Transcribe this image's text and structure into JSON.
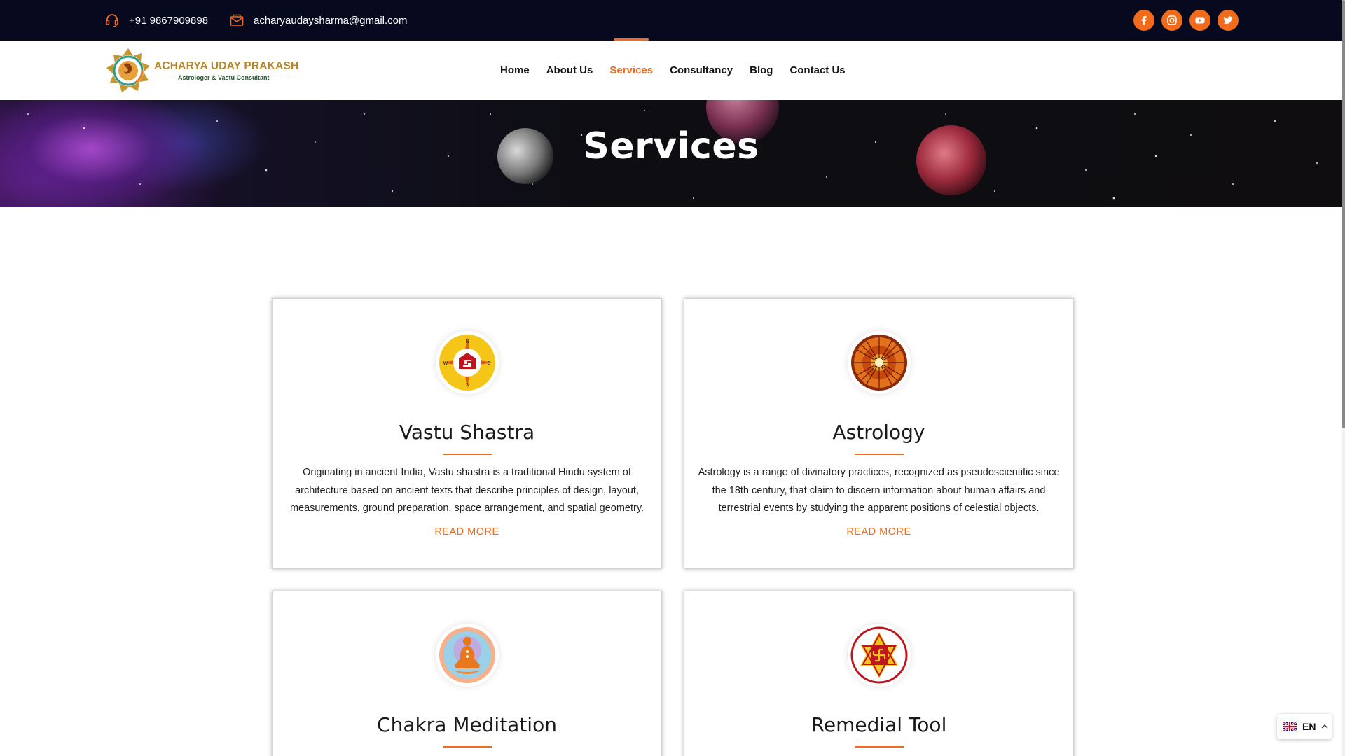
{
  "topbar": {
    "phone": "+91 9867909898",
    "email": "acharyaudaysharma@gmail.com",
    "socials": [
      "facebook-icon",
      "instagram-icon",
      "youtube-icon",
      "twitter-icon"
    ]
  },
  "brand": {
    "name": "ACHARYA UDAY PRAKASH",
    "tagline": "Astrologer & Vastu Consultant"
  },
  "nav": {
    "items": [
      {
        "label": "Home",
        "active": false
      },
      {
        "label": "About Us",
        "active": false
      },
      {
        "label": "Services",
        "active": true
      },
      {
        "label": "Consultancy",
        "active": false
      },
      {
        "label": "Blog",
        "active": false
      },
      {
        "label": "Contact Us",
        "active": false
      }
    ]
  },
  "hero": {
    "title": "Services"
  },
  "services": [
    {
      "title": "Vastu Shastra",
      "icon": "vastu-compass-icon",
      "description": "Originating in ancient India, Vastu shastra is a traditional Hindu system of architecture based on ancient texts that describe principles of design, layout, measurements, ground preparation, space arrangement, and spatial geometry.",
      "link": "READ MORE"
    },
    {
      "title": "Astrology",
      "icon": "zodiac-wheel-icon",
      "description": "Astrology is a range of divinatory practices, recognized as pseudoscientific since the 18th century, that claim to discern information about human affairs and terrestrial events by studying the apparent positions of celestial objects.",
      "link": "READ MORE"
    },
    {
      "title": "Chakra Meditation",
      "icon": "meditation-icon"
    },
    {
      "title": "Remedial Tool",
      "icon": "hexagram-swastika-icon"
    }
  ],
  "language": {
    "code": "EN"
  },
  "colors": {
    "accent": "#f26a1b",
    "topbar_bg": "#070a1e",
    "brand_gold": "#b8862a"
  }
}
